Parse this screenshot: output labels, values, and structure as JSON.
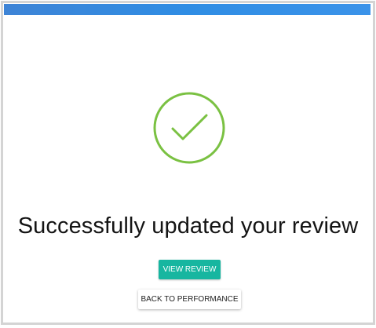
{
  "header": {
    "bar_color": "#3490e6"
  },
  "status": {
    "icon": "checkmark-circle-icon",
    "icon_color": "#7ac142",
    "message": "Successfully updated your review"
  },
  "actions": {
    "view_review_label": "VIEW REVIEW",
    "view_review_color": "#17b6a0",
    "back_label": "BACK TO PERFORMANCE"
  }
}
